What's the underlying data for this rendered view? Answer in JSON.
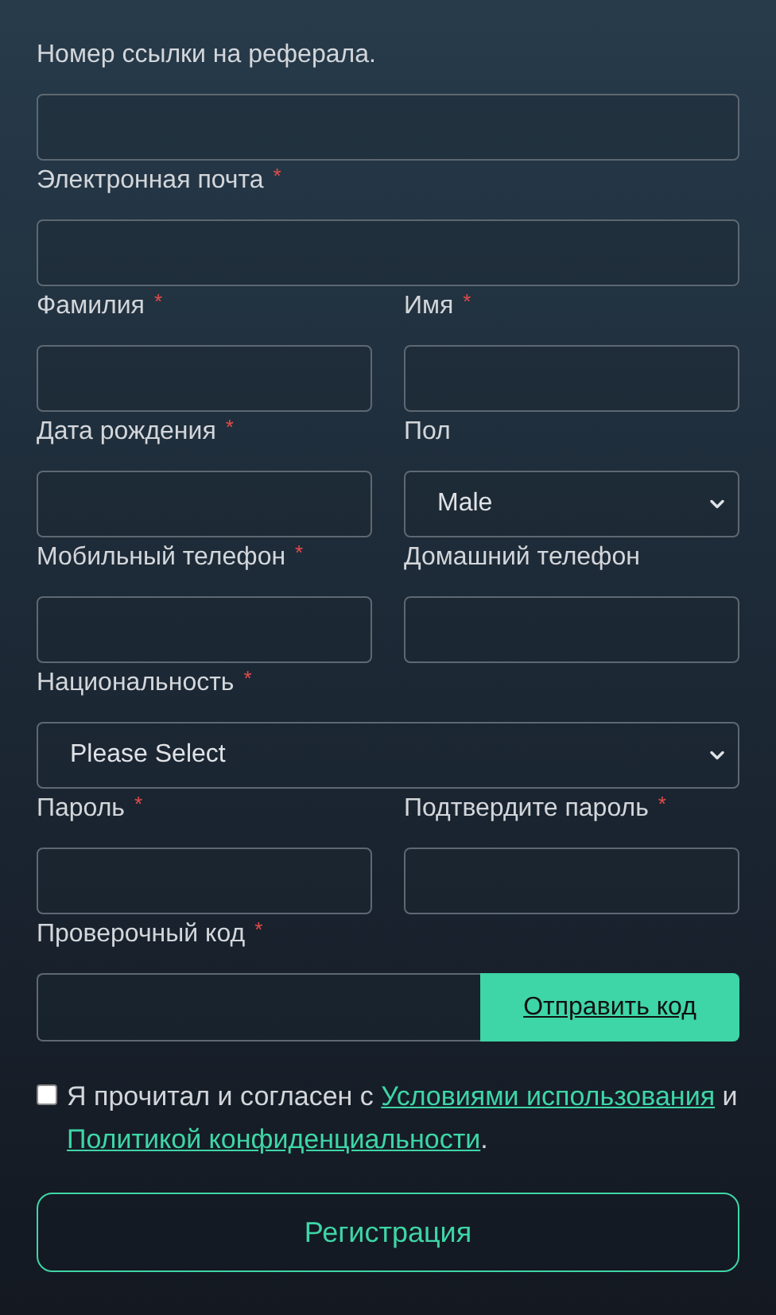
{
  "form": {
    "rows": [
      {
        "fields": [
          {
            "kind": "input",
            "label": "Номер ссылки на реферала."
          }
        ]
      },
      {
        "fields": [
          {
            "kind": "input",
            "label": "Электронная почта",
            "mark": "*"
          }
        ]
      },
      {
        "fields": [
          {
            "kind": "input",
            "label": "Фамилия",
            "mark": "*"
          },
          {
            "kind": "input",
            "label": "Имя",
            "mark": "*"
          }
        ]
      },
      {
        "fields": [
          {
            "kind": "input",
            "label": "Дата рождения",
            "mark": "*"
          },
          {
            "kind": "select",
            "label": "Пол",
            "value": "Male"
          }
        ]
      },
      {
        "fields": [
          {
            "kind": "input",
            "label": "Мобильный телефон",
            "mark": "*"
          },
          {
            "kind": "input",
            "label": "Домашний телефон"
          }
        ]
      },
      {
        "fields": [
          {
            "kind": "select",
            "label": "Национальность",
            "mark": "*",
            "value": "Please Select"
          }
        ]
      },
      {
        "fields": [
          {
            "kind": "input",
            "label": "Пароль",
            "mark": "*"
          },
          {
            "kind": "input",
            "label": "Подтвердите пароль",
            "mark": "*"
          }
        ]
      },
      {
        "fields": [
          {
            "kind": "code",
            "label": "Проверочный код",
            "mark": "*",
            "button": "Отправить код"
          }
        ]
      }
    ]
  },
  "agreement": {
    "checked": false,
    "parts": [
      {
        "kind": "text",
        "text": "Я прочитал и согласен с "
      },
      {
        "kind": "link",
        "text": "Условиями использования"
      },
      {
        "kind": "text",
        "text": " и "
      },
      {
        "kind": "link",
        "text": "Политикой конфиденциальности"
      },
      {
        "kind": "text",
        "text": "."
      }
    ]
  },
  "submit": "Регистрация"
}
